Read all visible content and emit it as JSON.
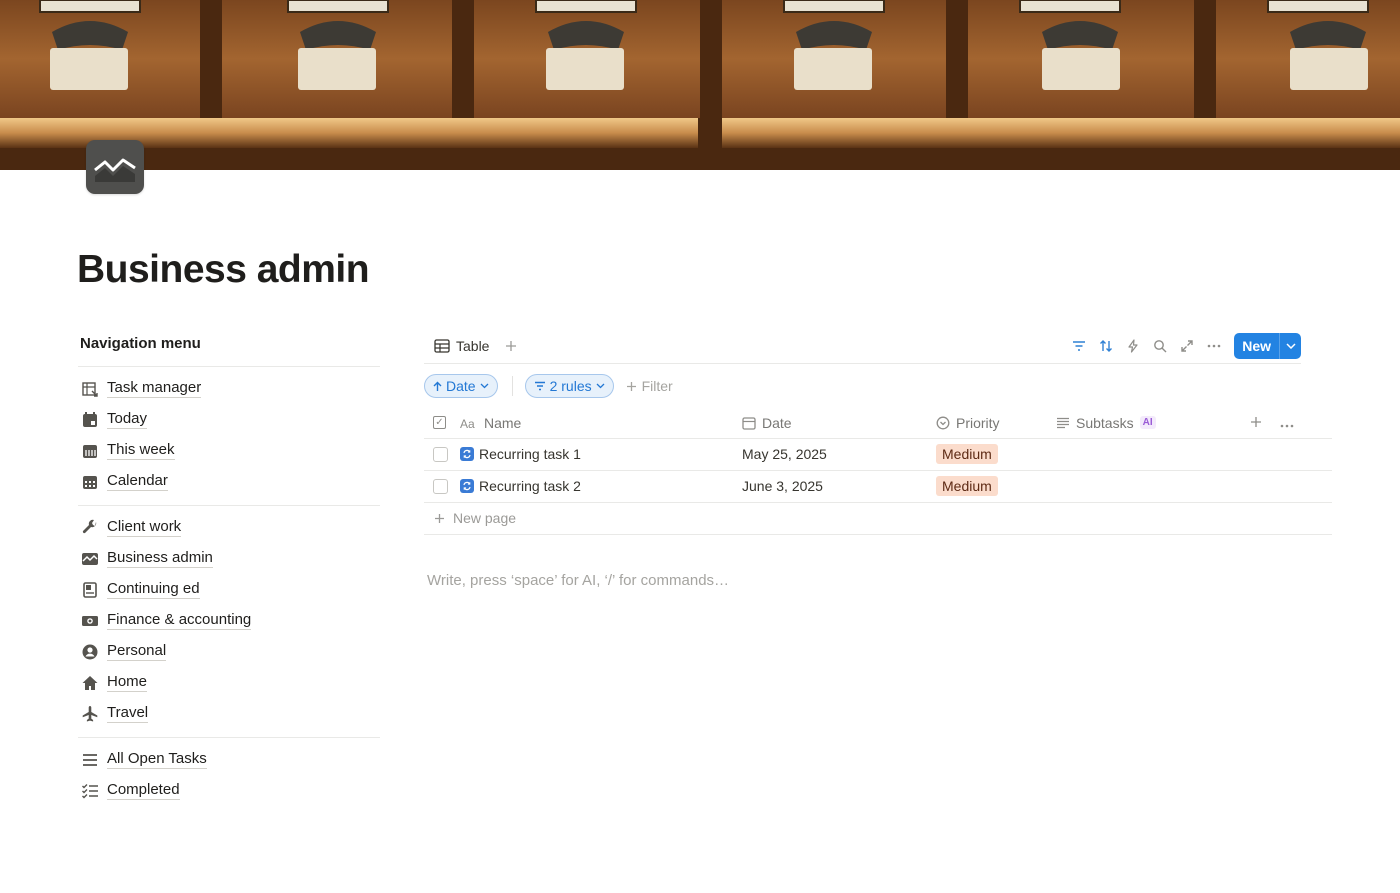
{
  "page": {
    "title": "Business admin",
    "icon": "chart-line-icon",
    "editor_placeholder": "Write, press ‘space’ for AI, ‘/’ for commands…"
  },
  "nav": {
    "heading": "Navigation menu",
    "groups": [
      [
        {
          "label": "Task manager",
          "icon": "database-link-icon"
        },
        {
          "label": "Today",
          "icon": "calendar-day-icon"
        },
        {
          "label": "This week",
          "icon": "calendar-week-icon"
        },
        {
          "label": "Calendar",
          "icon": "calendar-month-icon"
        }
      ],
      [
        {
          "label": "Client work",
          "icon": "wrench-icon"
        },
        {
          "label": "Business admin",
          "icon": "chart-line-icon"
        },
        {
          "label": "Continuing ed",
          "icon": "book-icon"
        },
        {
          "label": "Finance & accounting",
          "icon": "money-icon"
        },
        {
          "label": "Personal",
          "icon": "user-circle-icon"
        },
        {
          "label": "Home",
          "icon": "house-icon"
        },
        {
          "label": "Travel",
          "icon": "airplane-icon"
        }
      ],
      [
        {
          "label": "All Open Tasks",
          "icon": "list-icon"
        },
        {
          "label": "Completed",
          "icon": "checklist-icon"
        }
      ]
    ]
  },
  "database": {
    "view_tab": "Table",
    "new_button": "New",
    "sort_chip": "Date",
    "filter_chip": "2 rules",
    "filter_add": "Filter",
    "columns": {
      "name": "Name",
      "date": "Date",
      "priority": "Priority",
      "subtasks": "Subtasks",
      "subtasks_badge": "AI"
    },
    "rows": [
      {
        "name": "Recurring task 1",
        "date": "May 25, 2025",
        "priority": "Medium"
      },
      {
        "name": "Recurring task 2",
        "date": "June 3, 2025",
        "priority": "Medium"
      }
    ],
    "new_page": "New page",
    "accent_color": "#2383e2",
    "priority_color": "#fbdccc"
  }
}
